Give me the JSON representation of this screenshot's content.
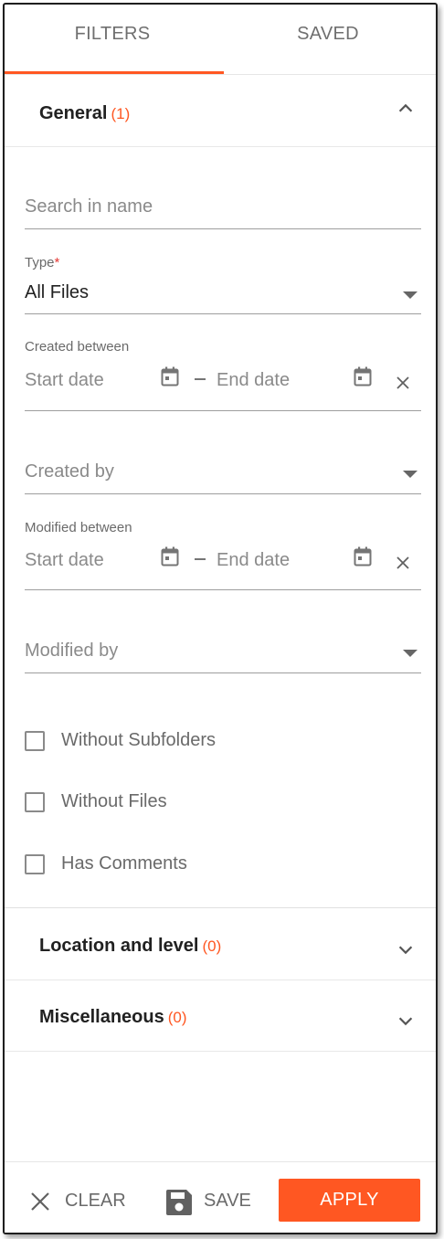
{
  "tabs": [
    {
      "label": "FILTERS",
      "active": true
    },
    {
      "label": "SAVED",
      "active": false
    }
  ],
  "sections": {
    "general": {
      "title": "General",
      "count": "(1)",
      "expanded": true
    },
    "location": {
      "title": "Location and level",
      "count": "(0)",
      "expanded": false
    },
    "misc": {
      "title": "Miscellaneous",
      "count": "(0)",
      "expanded": false
    }
  },
  "fields": {
    "search": {
      "placeholder": "Search in name",
      "value": ""
    },
    "type": {
      "label": "Type",
      "required_mark": "*",
      "value": "All Files"
    },
    "created_between": {
      "label": "Created between",
      "start_placeholder": "Start date",
      "end_placeholder": "End date"
    },
    "created_by": {
      "placeholder": "Created by"
    },
    "modified_between": {
      "label": "Modified between",
      "start_placeholder": "Start date",
      "end_placeholder": "End date"
    },
    "modified_by": {
      "placeholder": "Modified by"
    }
  },
  "checkboxes": [
    {
      "label": "Without Subfolders",
      "checked": false
    },
    {
      "label": "Without Files",
      "checked": false
    },
    {
      "label": "Has Comments",
      "checked": false
    }
  ],
  "footer": {
    "clear_label": "CLEAR",
    "save_label": "SAVE",
    "apply_label": "APPLY"
  },
  "colors": {
    "accent": "#ff5722",
    "required": "#e53935"
  },
  "icons": {
    "collapse": "chevron-up-icon",
    "expand": "chevron-down-icon",
    "dropdown": "caret-down-icon",
    "calendar": "calendar-icon",
    "clear": "close-icon",
    "save": "floppy-disk-icon"
  }
}
